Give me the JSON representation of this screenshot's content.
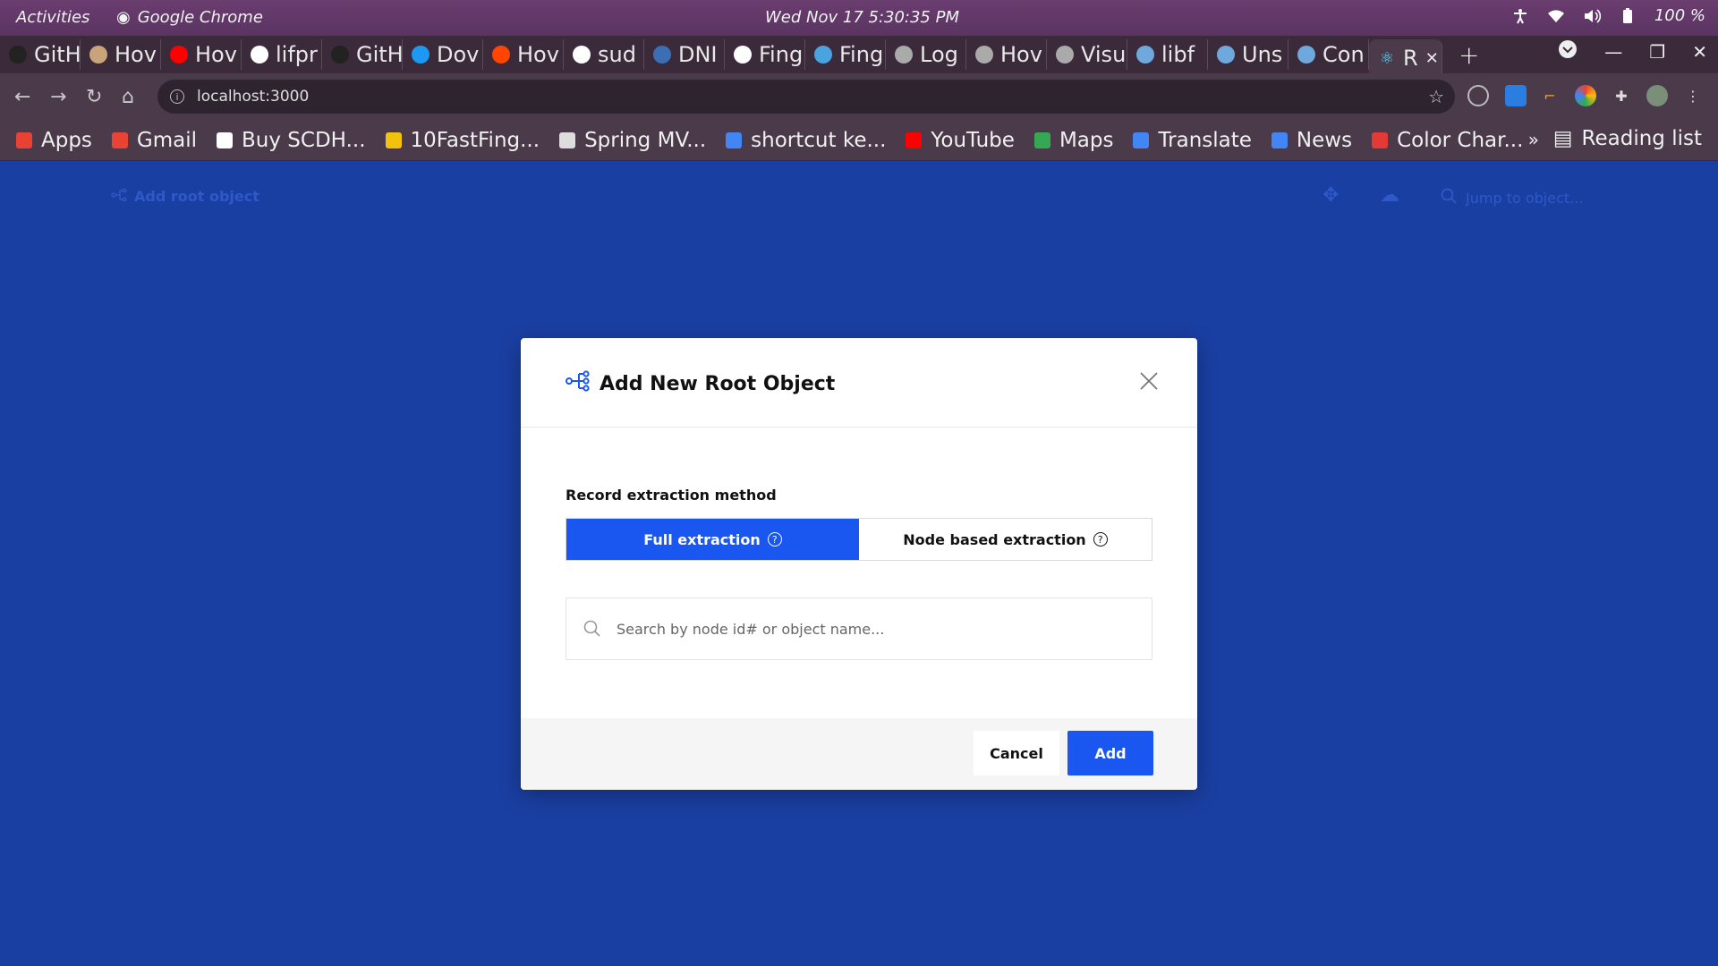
{
  "os": {
    "activities": "Activities",
    "app_name": "Google Chrome",
    "clock": "Wed Nov 17   5:30:35 PM",
    "battery": "100 %"
  },
  "browser": {
    "tabs": [
      {
        "label": "GitH",
        "icon": "github-icon",
        "color": "#222"
      },
      {
        "label": "Hov",
        "icon": "generic-icon",
        "color": "#c9a37a"
      },
      {
        "label": "Hov",
        "icon": "youtube-icon",
        "color": "#ff0000"
      },
      {
        "label": "lifpr",
        "icon": "globe-icon",
        "color": "#fff"
      },
      {
        "label": "GitH",
        "icon": "github-icon",
        "color": "#222"
      },
      {
        "label": "Dov",
        "icon": "kde-icon",
        "color": "#1d99f3"
      },
      {
        "label": "Hov",
        "icon": "reddit-icon",
        "color": "#ff4500"
      },
      {
        "label": "sud",
        "icon": "google-icon",
        "color": "#fff"
      },
      {
        "label": "DNI",
        "icon": "fedora-icon",
        "color": "#3c6eb4"
      },
      {
        "label": "Fing",
        "icon": "globe-icon",
        "color": "#fff"
      },
      {
        "label": "Fing",
        "icon": "bulb-icon",
        "color": "#4aa3df"
      },
      {
        "label": "Log",
        "icon": "feather-icon",
        "color": "#aaa"
      },
      {
        "label": "Hov",
        "icon": "feather-icon",
        "color": "#aaa"
      },
      {
        "label": "Visu",
        "icon": "feather-icon",
        "color": "#aaa"
      },
      {
        "label": "libf",
        "icon": "image-icon",
        "color": "#6fa8dc"
      },
      {
        "label": "Uns",
        "icon": "image-icon",
        "color": "#6fa8dc"
      },
      {
        "label": "Con",
        "icon": "image-icon",
        "color": "#6fa8dc"
      }
    ],
    "active_tab": {
      "label": "R",
      "icon": "react-icon"
    },
    "url": "localhost:3000",
    "bookmarks": [
      {
        "label": "Apps",
        "color": "#e94235"
      },
      {
        "label": "Gmail",
        "color": "#ea4335"
      },
      {
        "label": "Buy SCDH...",
        "color": "#ffffff"
      },
      {
        "label": "10FastFing...",
        "color": "#f4c20d"
      },
      {
        "label": "Spring MV...",
        "color": "#dddddd"
      },
      {
        "label": "shortcut ke...",
        "color": "#4285f4"
      },
      {
        "label": "YouTube",
        "color": "#ff0000"
      },
      {
        "label": "Maps",
        "color": "#34a853"
      },
      {
        "label": "Translate",
        "color": "#4285f4"
      },
      {
        "label": "News",
        "color": "#4285f4"
      },
      {
        "label": "Color Char...",
        "color": "#e53935"
      }
    ],
    "bookmarks_more": "»",
    "reading_list": "Reading list"
  },
  "app": {
    "add_root_label": "Add root object",
    "jump_placeholder": "Jump to object..."
  },
  "modal": {
    "title": "Add New Root Object",
    "section_label": "Record extraction method",
    "options": [
      {
        "label": "Full extraction",
        "selected": true
      },
      {
        "label": "Node based extraction",
        "selected": false
      }
    ],
    "search_placeholder": "Search by node id# or object name...",
    "cancel_label": "Cancel",
    "add_label": "Add",
    "accent_color": "#1a56f0"
  }
}
